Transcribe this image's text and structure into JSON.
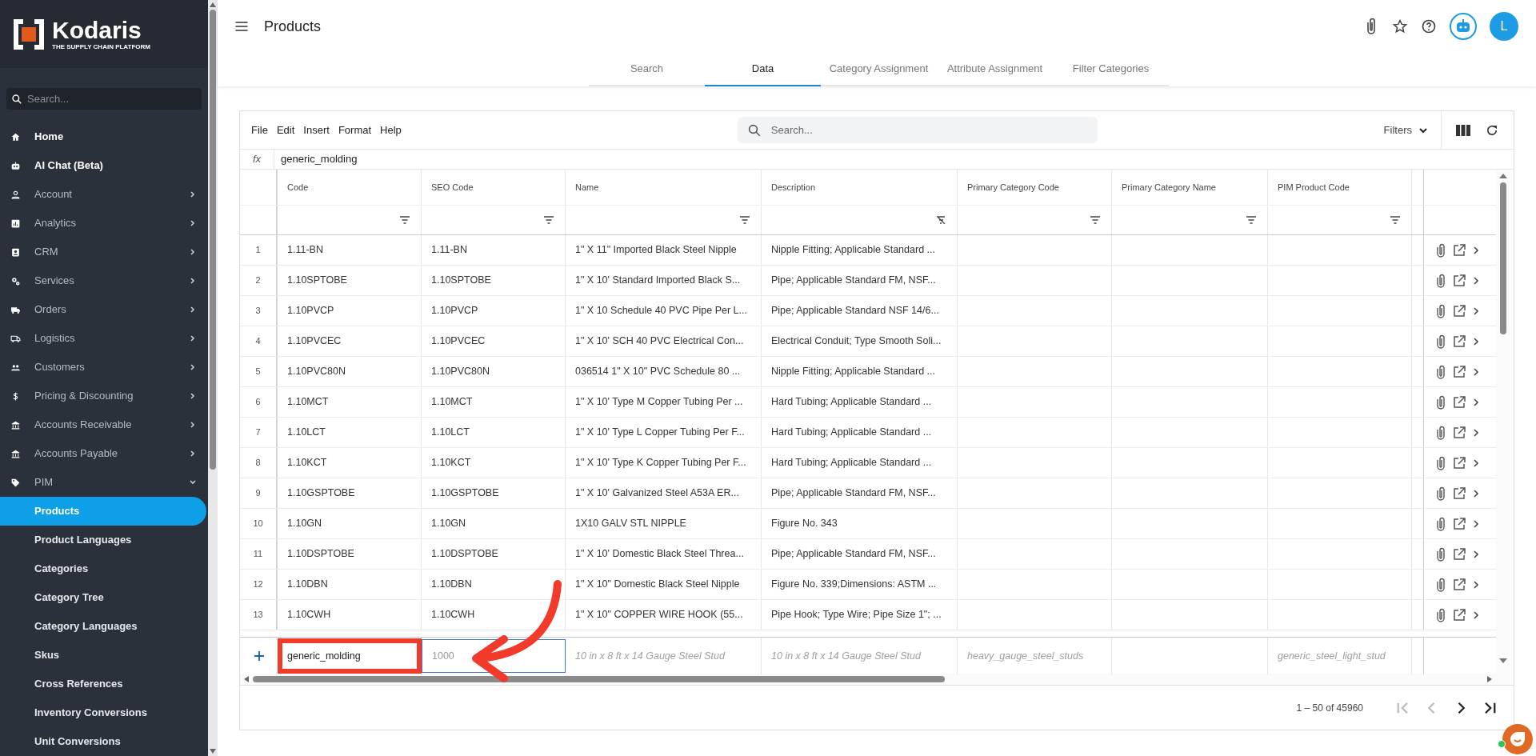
{
  "sidebar": {
    "logo": "Kodaris",
    "tagline": "THE SUPPLY CHAIN PLATFORM",
    "search": {
      "placeholder": "Search..."
    },
    "items": [
      {
        "label": "Home",
        "kind": "link"
      },
      {
        "label": "AI Chat (Beta)",
        "kind": "link"
      },
      {
        "label": "Account",
        "kind": "group",
        "expanded": false
      },
      {
        "label": "Analytics",
        "kind": "group",
        "expanded": false
      },
      {
        "label": "CRM",
        "kind": "group",
        "expanded": false
      },
      {
        "label": "Services",
        "kind": "group",
        "expanded": false
      },
      {
        "label": "Orders",
        "kind": "group",
        "expanded": false
      },
      {
        "label": "Logistics",
        "kind": "group",
        "expanded": false
      },
      {
        "label": "Customers",
        "kind": "group",
        "expanded": false
      },
      {
        "label": "Pricing & Discounting",
        "kind": "group",
        "expanded": false
      },
      {
        "label": "Accounts Receivable",
        "kind": "group",
        "expanded": false
      },
      {
        "label": "Accounts Payable",
        "kind": "group",
        "expanded": false
      },
      {
        "label": "PIM",
        "kind": "group",
        "expanded": true,
        "children": [
          {
            "label": "Products",
            "selected": true
          },
          {
            "label": "Product Languages",
            "selected": false
          },
          {
            "label": "Categories",
            "selected": false
          },
          {
            "label": "Category Tree",
            "selected": false
          },
          {
            "label": "Category Languages",
            "selected": false
          },
          {
            "label": "Skus",
            "selected": false
          },
          {
            "label": "Cross References",
            "selected": false
          },
          {
            "label": "Inventory Conversions",
            "selected": false
          },
          {
            "label": "Unit Conversions",
            "selected": false
          }
        ]
      }
    ]
  },
  "header": {
    "title": "Products",
    "avatar": "L"
  },
  "tabs": [
    {
      "label": "Search",
      "selected": false
    },
    {
      "label": "Data",
      "selected": true
    },
    {
      "label": "Category Assignment",
      "selected": false
    },
    {
      "label": "Attribute Assignment",
      "selected": false
    },
    {
      "label": "Filter Categories",
      "selected": false
    }
  ],
  "toolbar": {
    "menus": [
      "File",
      "Edit",
      "Insert",
      "Format",
      "Help"
    ],
    "search": {
      "placeholder": "Search..."
    },
    "filters": "Filters"
  },
  "formula_bar": {
    "label": "fx",
    "value": "generic_molding"
  },
  "table": {
    "columns": [
      {
        "label": "Code",
        "filtered": false
      },
      {
        "label": "SEO Code",
        "filtered": false
      },
      {
        "label": "Name",
        "filtered": false
      },
      {
        "label": "Description",
        "filtered": true
      },
      {
        "label": "Primary Category Code",
        "filtered": false
      },
      {
        "label": "Primary Category Name",
        "filtered": false
      },
      {
        "label": "PIM Product Code",
        "filtered": false
      }
    ],
    "rows": [
      {
        "number": "1",
        "cells": [
          "1.11-BN",
          "1.11-BN",
          "1\" X 11\" Imported Black Steel Nipple",
          "Nipple Fitting; Applicable Standard ..."
        ]
      },
      {
        "number": "2",
        "cells": [
          "1.10SPTOBE",
          "1.10SPTOBE",
          "1\" X 10' Standard Imported Black S...",
          "Pipe; Applicable Standard FM, NSF..."
        ]
      },
      {
        "number": "3",
        "cells": [
          "1.10PVCP",
          "1.10PVCP",
          "1\" X 10 Schedule 40 PVC Pipe Per L...",
          "Pipe; Applicable Standard NSF 14/6..."
        ]
      },
      {
        "number": "4",
        "cells": [
          "1.10PVCEC",
          "1.10PVCEC",
          "1\" X 10' SCH 40 PVC Electrical Con...",
          "Electrical Conduit; Type Smooth Soli..."
        ]
      },
      {
        "number": "5",
        "cells": [
          "1.10PVC80N",
          "1.10PVC80N",
          "036514 1\" X 10\" PVC Schedule 80 ...",
          "Nipple Fitting; Applicable Standard ..."
        ]
      },
      {
        "number": "6",
        "cells": [
          "1.10MCT",
          "1.10MCT",
          "1\" X 10' Type M Copper Tubing Per ...",
          "Hard Tubing; Applicable Standard ..."
        ]
      },
      {
        "number": "7",
        "cells": [
          "1.10LCT",
          "1.10LCT",
          "1\" X 10' Type L Copper Tubing Per F...",
          "Hard Tubing; Applicable Standard ..."
        ]
      },
      {
        "number": "8",
        "cells": [
          "1.10KCT",
          "1.10KCT",
          "1\" X 10' Type K Copper Tubing Per F...",
          "Hard Tubing; Applicable Standard ..."
        ]
      },
      {
        "number": "9",
        "cells": [
          "1.10GSPTOBE",
          "1.10GSPTOBE",
          "1\" X 10' Galvanized Steel A53A ER...",
          "Pipe; Applicable Standard FM, NSF..."
        ]
      },
      {
        "number": "10",
        "cells": [
          "1.10GN",
          "1.10GN",
          "1X10 GALV STL NIPPLE",
          "Figure No. 343"
        ]
      },
      {
        "number": "11",
        "cells": [
          "1.10DSPTOBE",
          "1.10DSPTOBE",
          "1\" X 10' Domestic Black Steel Threa...",
          "Pipe; Applicable Standard FM, NSF..."
        ]
      },
      {
        "number": "12",
        "cells": [
          "1.10DBN",
          "1.10DBN",
          "1\" X 10\" Domestic Black Steel Nipple",
          "Figure No. 339;Dimensions: ASTM ..."
        ]
      },
      {
        "number": "13",
        "cells": [
          "1.10CWH",
          "1.10CWH",
          "1\" X 10\" COPPER WIRE HOOK (55...",
          "Pipe Hook; Type Wire; Pipe Size 1\"; ..."
        ]
      }
    ],
    "new_row": {
      "code": "generic_molding",
      "seo_code": "1000",
      "cells": [
        {
          "kind": "placeholder",
          "placeholder": "10 in x 8 ft x 14 Gauge Steel Stud"
        },
        {
          "kind": "placeholder",
          "placeholder": "10 in x 8 ft x 14 Gauge Steel Stud"
        },
        {
          "kind": "placeholder",
          "placeholder": "heavy_gauge_steel_studs"
        },
        {
          "kind": "empty"
        },
        {
          "kind": "placeholder",
          "placeholder": "generic_steel_light_stud"
        }
      ]
    }
  },
  "pagination": {
    "range": "1 – 50 of 45960",
    "buttons": [
      {
        "kind": "first",
        "disabled": true
      },
      {
        "kind": "prev",
        "disabled": true
      },
      {
        "kind": "next",
        "disabled": false
      },
      {
        "kind": "last",
        "disabled": false
      }
    ]
  }
}
